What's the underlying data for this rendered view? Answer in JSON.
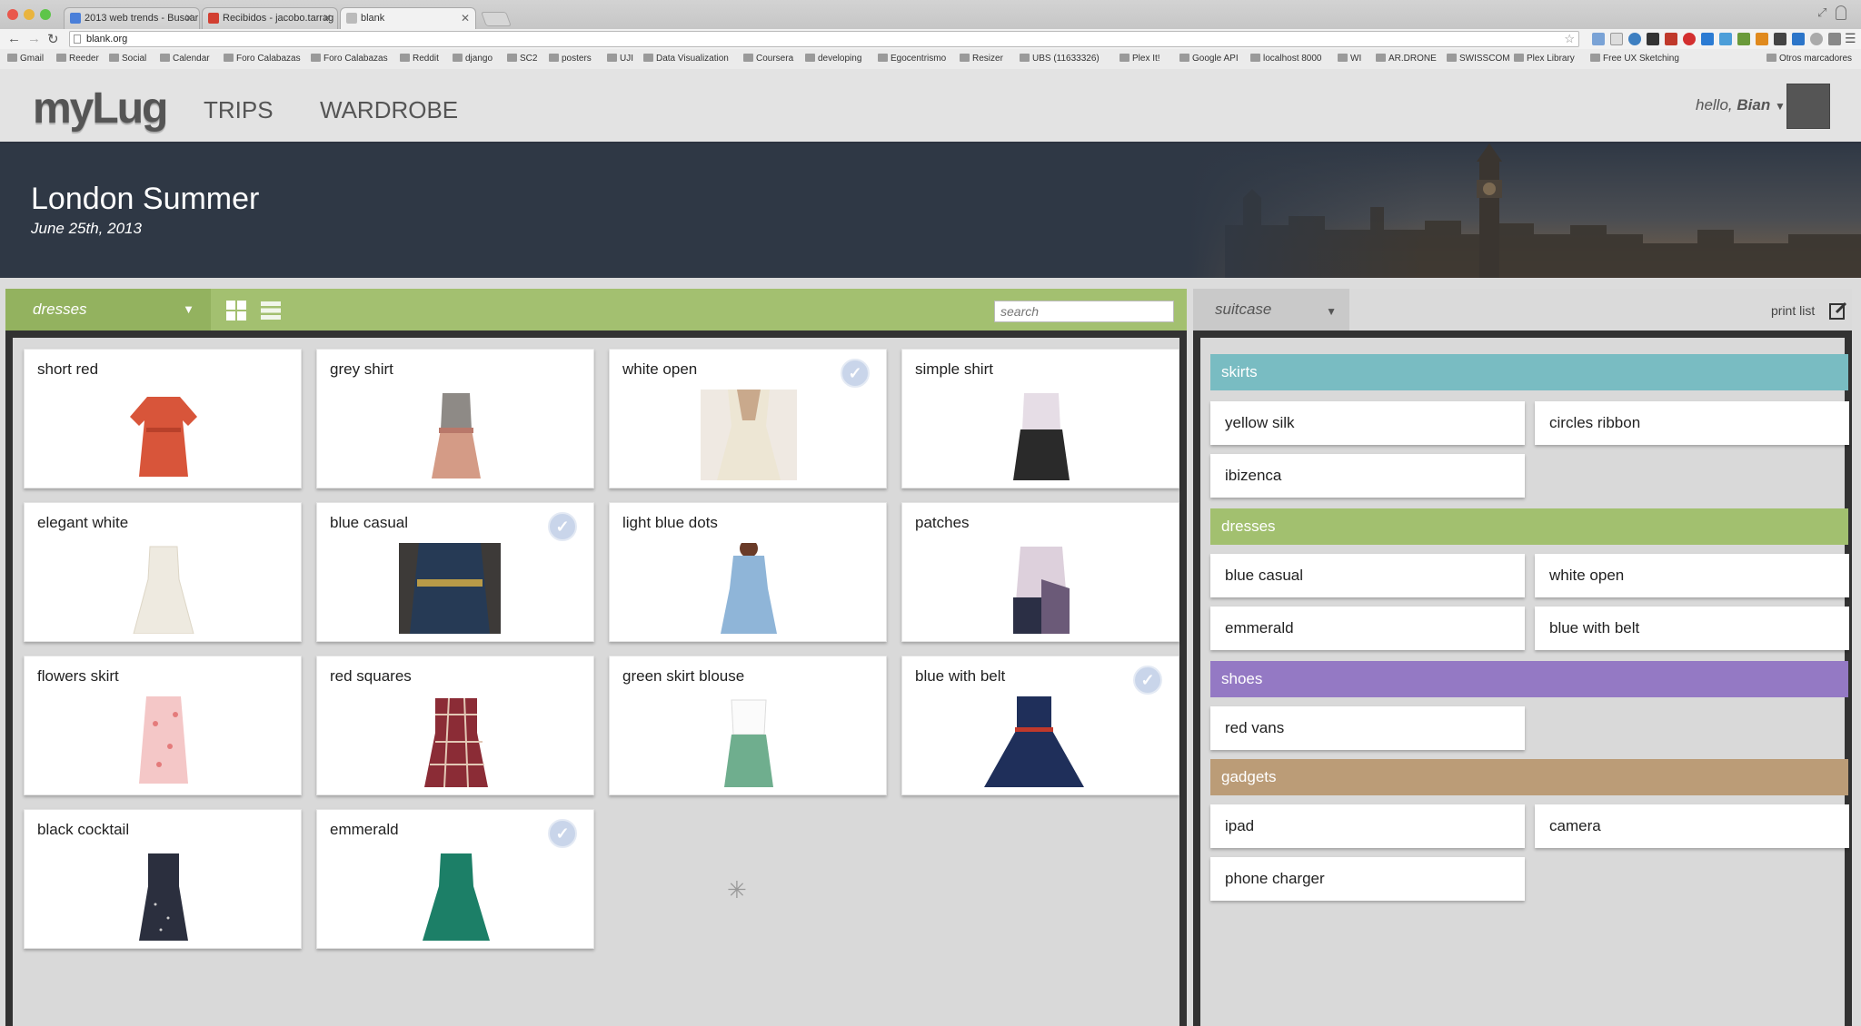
{
  "browser": {
    "tabs": [
      {
        "label": "2013 web trends - Buscar"
      },
      {
        "label": "Recibidos - jacobo.tarrag"
      },
      {
        "label": "blank"
      }
    ],
    "url": "blank.org",
    "bookmarks": [
      "Gmail",
      "Reeder",
      "Social",
      "Calendar",
      "Foro Calabazas",
      "Foro Calabazas",
      "Reddit",
      "django",
      "SC2",
      "posters",
      "UJI",
      "Data Visualization",
      "Coursera",
      "developing",
      "Egocentrismo",
      "Resizer",
      "UBS (11633326)",
      "Plex It!",
      "Google API",
      "localhost 8000",
      "WI",
      "AR.DRONE",
      "SWISSCOM",
      "Plex Library",
      "Free UX Sketching",
      "Otros marcadores"
    ]
  },
  "app": {
    "logo": "myLug",
    "nav": [
      "TRIPS",
      "WARDROBE"
    ],
    "hello": "hello,",
    "user": "Bian"
  },
  "trip": {
    "title": "London Summer",
    "date": "June 25th, 2013"
  },
  "wardrobe": {
    "category": "dresses",
    "search_placeholder": "search",
    "items": [
      {
        "label": "short red",
        "checked": false,
        "color": "#d8553a"
      },
      {
        "label": "grey shirt",
        "checked": false,
        "color": "#d49b86"
      },
      {
        "label": "white open",
        "checked": true,
        "color": "#ede6d4"
      },
      {
        "label": "simple shirt",
        "checked": false,
        "color": "#2a2a2a"
      },
      {
        "label": "elegant white",
        "checked": false,
        "color": "#eeeae0"
      },
      {
        "label": "blue casual",
        "checked": true,
        "color": "#263a55"
      },
      {
        "label": "light blue dots",
        "checked": false,
        "color": "#8fb5d8"
      },
      {
        "label": "patches",
        "checked": false,
        "color": "#6b5a78"
      },
      {
        "label": "flowers skirt",
        "checked": false,
        "color": "#f4c7c7"
      },
      {
        "label": "red squares",
        "checked": false,
        "color": "#8b2c36"
      },
      {
        "label": "green skirt blouse",
        "checked": false,
        "color": "#6fae8e"
      },
      {
        "label": "blue with belt",
        "checked": true,
        "color": "#1f2f5a"
      },
      {
        "label": "black cocktail",
        "checked": false,
        "color": "#2b2f3e"
      },
      {
        "label": "emmerald",
        "checked": true,
        "color": "#1c7f67"
      }
    ]
  },
  "suitcase": {
    "selector": "suitcase",
    "print_label": "print list",
    "categories": [
      {
        "name": "skirts",
        "color": "#79bcc2",
        "items": [
          "yellow silk",
          "circles ribbon",
          "ibizenca"
        ]
      },
      {
        "name": "dresses",
        "color": "#a2c06f",
        "items": [
          "blue casual",
          "white open",
          "emmerald",
          "blue with belt"
        ]
      },
      {
        "name": "shoes",
        "color": "#9479c4",
        "items": [
          "red vans"
        ]
      },
      {
        "name": "gadgets",
        "color": "#bb9c77",
        "items": [
          "ipad",
          "camera",
          "phone charger"
        ]
      }
    ]
  }
}
